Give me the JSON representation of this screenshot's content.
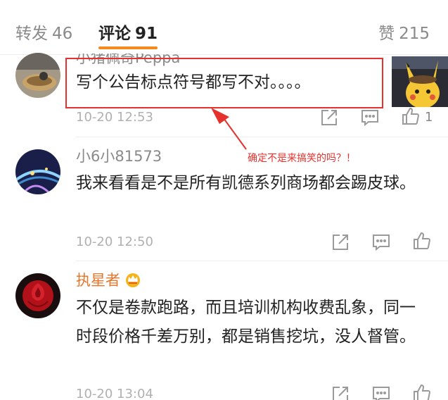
{
  "tabs": {
    "reposts": {
      "label": "转发",
      "count": "46"
    },
    "comments": {
      "label": "评论",
      "count": "91"
    },
    "likes": {
      "label": "赞",
      "count": "215"
    }
  },
  "comments": [
    {
      "username": "小猪佩奇Peppa",
      "text": "写个公告标点符号都写不对。。。。",
      "time": "10-20 12:53",
      "like_count": "1"
    },
    {
      "username": "小6小81573",
      "text": "我来看看是不是所有凯德系列商场都会踢皮球。",
      "time": "10-20 12:50"
    },
    {
      "username": "执星者",
      "text": "不仅是卷款跑路，而且培训机构收费乱象，同一时段价格千差万别，都是销售挖坑，没人督管。",
      "time": "10-20 13:04"
    }
  ],
  "annotation": {
    "text": "确定不是来搞笑的吗？！"
  },
  "colors": {
    "accent": "#f58b1f",
    "annotation": "#e5322d",
    "vip_name": "#e8772e"
  },
  "icons": [
    "share-icon",
    "comment-icon",
    "like-icon",
    "vip-crown-icon"
  ]
}
